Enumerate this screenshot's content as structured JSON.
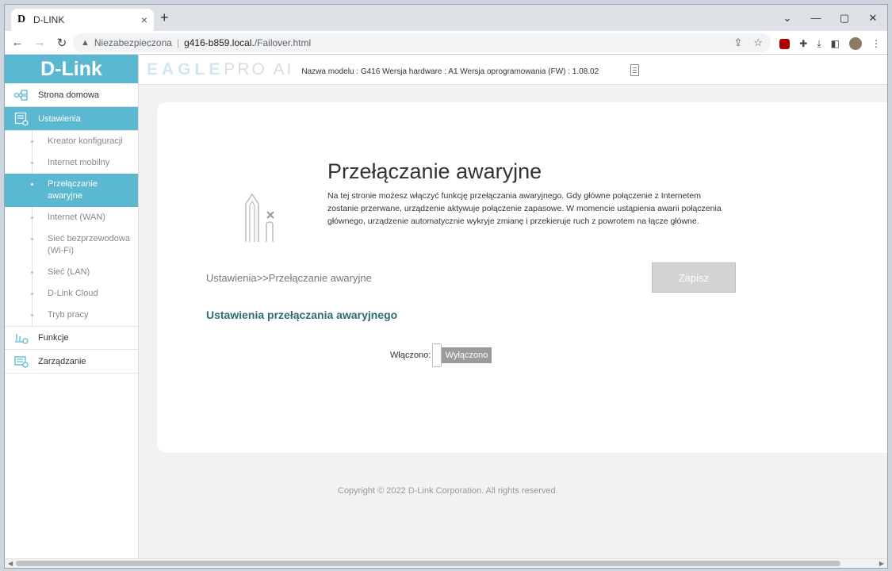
{
  "browser": {
    "tab_title": "D-LINK",
    "tab_favicon": "D",
    "new_tab": "+",
    "close_tab": "×",
    "security_label": "Niezabezpieczona",
    "url_host": "g416-b859.local.",
    "url_path": "/Failover.html",
    "icons": [
      "back-icon",
      "forward-icon",
      "reload-icon",
      "share-icon",
      "star-icon",
      "ublock-icon",
      "extensions-icon",
      "download-icon",
      "sidebar-icon",
      "profile-icon",
      "menu-icon"
    ]
  },
  "router": {
    "logo": "D-Link",
    "brand_a": "EAGLE",
    "brand_b": "PRO AI",
    "model_info": "Nazwa modelu : G416 Wersja hardware : A1 Wersja oprogramowania (FW) : 1.08.02",
    "accent_color": "#5bb8d1"
  },
  "sidebar": {
    "home": "Strona domowa",
    "settings": "Ustawienia",
    "sub_items": [
      {
        "label": "Kreator konfiguracji"
      },
      {
        "label": "Internet mobilny"
      },
      {
        "label": "Przełączanie awaryjne",
        "active": true
      },
      {
        "label": "Internet (WAN)"
      },
      {
        "label": "Sieć bezprzewodowa (Wi-Fi)"
      },
      {
        "label": "Sieć (LAN)"
      },
      {
        "label": "D-Link Cloud"
      },
      {
        "label": "Tryb pracy"
      }
    ],
    "features": "Funkcje",
    "management": "Zarządzanie"
  },
  "main": {
    "title": "Przełączanie awaryjne",
    "description": "Na tej stronie możesz włączyć funkcję przełączania awaryjnego. Gdy główne połączenie z Internetem zostanie przerwane, urządzenie aktywuje połączenie zapasowe. W momencie ustąpienia awarii połączenia głównego, urządzenie automatycznie wykryje zmianę i przekieruje ruch z powrotem na łącze główne.",
    "breadcrumb": "Ustawienia>>Przełączanie awaryjne",
    "save_label": "Zapisz",
    "section_title": "Ustawienia przełączania awaryjnego",
    "enabled_label": "Włączono:",
    "toggle_state": "Wyłączono"
  },
  "footer": {
    "copyright": "Copyright © 2022 D-Link Corporation. All rights reserved."
  }
}
